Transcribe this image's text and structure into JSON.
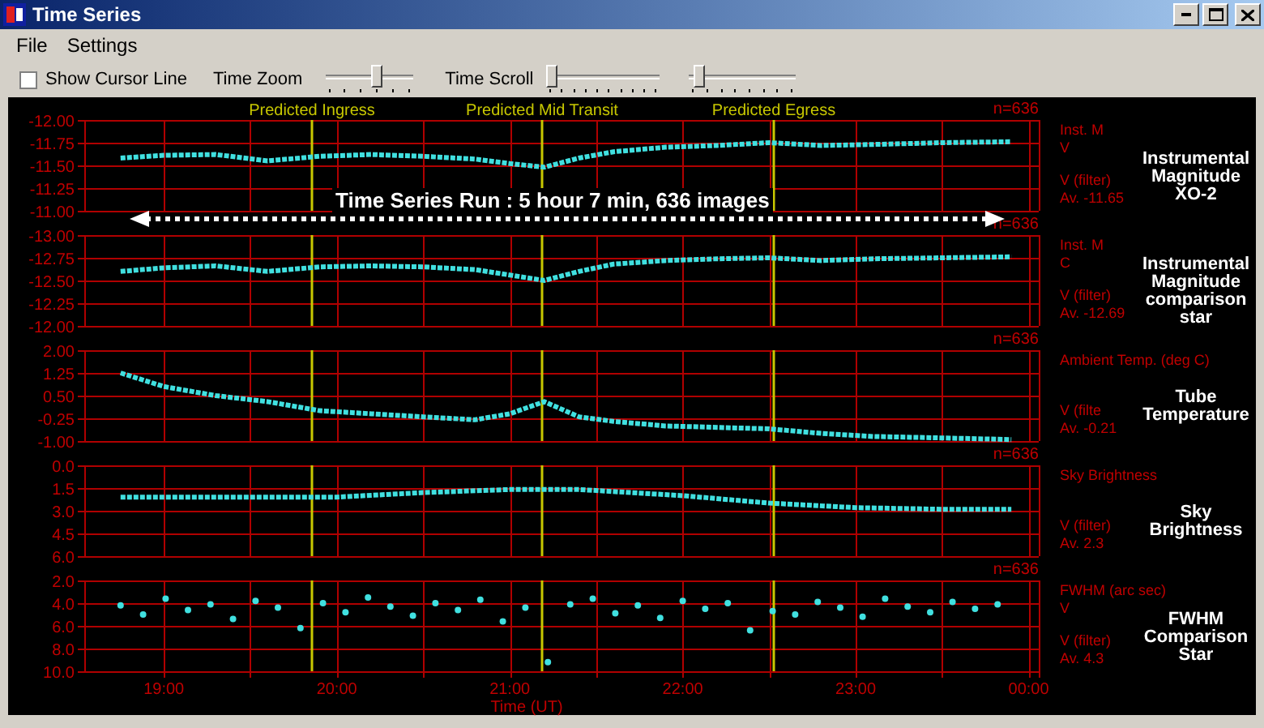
{
  "window": {
    "title": "Time Series"
  },
  "menu": [
    {
      "label": "File"
    },
    {
      "label": "Settings"
    }
  ],
  "toolbar": {
    "show_cursor_line": {
      "label": "Show Cursor Line",
      "checked": false
    },
    "time_zoom": {
      "label": "Time Zoom",
      "level": 0.6
    },
    "time_scroll": {
      "label": "Time Scroll",
      "level": 0.0
    },
    "slider_3": {
      "level": 0.05
    }
  },
  "run_annotation": "Time Series Run : 5 hour 7 min, 636 images",
  "panels": [
    {
      "count": "n=636",
      "quantity": "Inst. M",
      "unit": "V",
      "filter": "V (filter)",
      "average": "Av.  -11.65",
      "note": "Instrumental Magnitude XO-2",
      "chart_data": {
        "type": "line",
        "grid": true,
        "x": [
          18.75,
          19.0,
          19.3,
          19.6,
          19.9,
          20.2,
          20.5,
          20.8,
          21.0,
          21.2,
          21.4,
          21.6,
          21.9,
          22.2,
          22.5,
          22.8,
          23.1,
          23.5,
          23.9
        ],
        "series": [
          {
            "color": "#40e0e0",
            "line_style": "dotted",
            "values": [
              -11.58,
              -11.61,
              -11.62,
              -11.55,
              -11.6,
              -11.62,
              -11.6,
              -11.57,
              -11.52,
              -11.48,
              -11.58,
              -11.65,
              -11.7,
              -11.72,
              -11.75,
              -11.72,
              -11.73,
              -11.75,
              -11.76
            ]
          }
        ],
        "xlim": [
          18.54,
          24.03
        ],
        "ylim": [
          -11,
          -12
        ],
        "yticks": [
          {
            "value": -12,
            "label": "-12.00"
          },
          {
            "value": -11.75,
            "label": "-11.75"
          },
          {
            "value": -11.5,
            "label": "-11.50"
          },
          {
            "value": -11.25,
            "label": "-11.25"
          },
          {
            "value": -11,
            "label": "-11.00"
          }
        ],
        "ref_lines": [
          {
            "axis": "x",
            "value": 19.85,
            "color": "#c8c800",
            "label": "Predicted Ingress"
          },
          {
            "axis": "x",
            "value": 21.18,
            "color": "#c8c800",
            "label": "Predicted Mid Transit"
          },
          {
            "axis": "x",
            "value": 22.52,
            "color": "#c8c800",
            "label": "Predicted Egress"
          }
        ]
      }
    },
    {
      "count": "n=636",
      "quantity": "Inst. M",
      "unit": "C",
      "filter": "V (filter)",
      "average": "Av.  -12.69",
      "note": "Instrumental Magnitude comparison star",
      "chart_data": {
        "type": "line",
        "grid": true,
        "x": [
          18.75,
          19.0,
          19.3,
          19.6,
          19.9,
          20.2,
          20.5,
          20.8,
          21.0,
          21.2,
          21.4,
          21.6,
          21.9,
          22.2,
          22.5,
          22.8,
          23.1,
          23.5,
          23.9
        ],
        "series": [
          {
            "color": "#40e0e0",
            "line_style": "dotted",
            "values": [
              -12.6,
              -12.64,
              -12.66,
              -12.6,
              -12.65,
              -12.66,
              -12.65,
              -12.62,
              -12.56,
              -12.5,
              -12.6,
              -12.68,
              -12.72,
              -12.74,
              -12.75,
              -12.72,
              -12.74,
              -12.75,
              -12.76
            ]
          }
        ],
        "xlim": [
          18.54,
          24.03
        ],
        "ylim": [
          -12,
          -13
        ],
        "yticks": [
          {
            "value": -13,
            "label": "-13.00"
          },
          {
            "value": -12.75,
            "label": "-12.75"
          },
          {
            "value": -12.5,
            "label": "-12.50"
          },
          {
            "value": -12.25,
            "label": "-12.25"
          },
          {
            "value": -12,
            "label": "-12.00"
          }
        ],
        "ref_lines": [
          {
            "axis": "x",
            "value": 19.85,
            "color": "#c8c800"
          },
          {
            "axis": "x",
            "value": 21.18,
            "color": "#c8c800"
          },
          {
            "axis": "x",
            "value": 22.52,
            "color": "#c8c800"
          }
        ]
      }
    },
    {
      "count": "n=636",
      "quantity": "Ambient Temp. (deg C)",
      "filter": "V (filte",
      "average": "Av.  -0.21",
      "note": "Tube Temperature",
      "chart_data": {
        "type": "line",
        "grid": true,
        "x": [
          18.75,
          19.0,
          19.3,
          19.6,
          19.9,
          20.2,
          20.5,
          20.8,
          21.0,
          21.2,
          21.4,
          21.6,
          21.9,
          22.2,
          22.5,
          22.8,
          23.1,
          23.5,
          23.9
        ],
        "series": [
          {
            "color": "#40e0e0",
            "line_style": "dotted",
            "values": [
              1.25,
              0.8,
              0.5,
              0.3,
              0.0,
              -0.1,
              -0.2,
              -0.3,
              -0.1,
              0.3,
              -0.2,
              -0.35,
              -0.5,
              -0.55,
              -0.6,
              -0.75,
              -0.85,
              -0.9,
              -0.95
            ]
          }
        ],
        "xlim": [
          18.54,
          24.03
        ],
        "ylim": [
          -1,
          2
        ],
        "yticks": [
          {
            "value": 2,
            "label": "2.00"
          },
          {
            "value": 1.25,
            "label": "1.25"
          },
          {
            "value": 0.5,
            "label": "0.50"
          },
          {
            "value": -0.25,
            "label": "-0.25"
          },
          {
            "value": -1,
            "label": "-1.00"
          }
        ],
        "ref_lines": [
          {
            "axis": "x",
            "value": 19.85,
            "color": "#c8c800"
          },
          {
            "axis": "x",
            "value": 21.18,
            "color": "#c8c800"
          },
          {
            "axis": "x",
            "value": 22.52,
            "color": "#c8c800"
          }
        ]
      }
    },
    {
      "count": "n=636",
      "quantity": "Sky Brightness",
      "filter": "V (filter)",
      "average": "Av.  2.3",
      "note": "Sky Brightness",
      "chart_data": {
        "type": "line",
        "grid": true,
        "x": [
          18.75,
          19.0,
          19.5,
          20.0,
          20.5,
          21.0,
          21.4,
          22.0,
          22.5,
          23.0,
          23.5,
          23.9
        ],
        "series": [
          {
            "color": "#40e0e0",
            "line_style": "dotted",
            "values": [
              2.1,
              2.1,
              2.1,
              2.1,
              1.8,
              1.6,
              1.6,
              2.0,
              2.5,
              2.8,
              2.9,
              2.9
            ]
          }
        ],
        "xlim": [
          18.54,
          24.03
        ],
        "ylim": [
          6,
          0
        ],
        "yticks": [
          {
            "value": 0,
            "label": "0.0"
          },
          {
            "value": 1.5,
            "label": "1.5"
          },
          {
            "value": 3,
            "label": "3.0"
          },
          {
            "value": 4.5,
            "label": "4.5"
          },
          {
            "value": 6,
            "label": "6.0"
          }
        ],
        "ref_lines": [
          {
            "axis": "x",
            "value": 19.85,
            "color": "#c8c800"
          },
          {
            "axis": "x",
            "value": 21.18,
            "color": "#c8c800"
          },
          {
            "axis": "x",
            "value": 22.52,
            "color": "#c8c800"
          }
        ]
      }
    },
    {
      "count": "n=636",
      "quantity": "FWHM (arc sec)",
      "unit": "V",
      "filter": "V (filter)",
      "average": "Av.  4.3",
      "note": "FWHM Comparison Star",
      "chart_data": {
        "type": "scatter",
        "grid": true,
        "x": [
          18.75,
          18.88,
          19.01,
          19.14,
          19.27,
          19.4,
          19.53,
          19.66,
          19.79,
          19.92,
          20.05,
          20.18,
          20.31,
          20.44,
          20.57,
          20.7,
          20.83,
          20.96,
          21.09,
          21.22,
          21.35,
          21.48,
          21.61,
          21.74,
          21.87,
          22.0,
          22.13,
          22.26,
          22.39,
          22.52,
          22.65,
          22.78,
          22.91,
          23.04,
          23.17,
          23.3,
          23.43,
          23.56,
          23.69,
          23.82
        ],
        "series": [
          {
            "color": "#40e0e0",
            "values": [
              4.2,
              5.0,
              3.6,
              4.6,
              4.1,
              5.4,
              3.8,
              4.4,
              6.2,
              4.0,
              4.8,
              3.5,
              4.3,
              5.1,
              4.0,
              4.6,
              3.7,
              5.6,
              4.4,
              9.2,
              4.1,
              3.6,
              4.9,
              4.2,
              5.3,
              3.8,
              4.5,
              4.0,
              6.4,
              4.7,
              5.0,
              3.9,
              4.4,
              5.2,
              3.6,
              4.3,
              4.8,
              3.9,
              4.5,
              4.1
            ]
          }
        ],
        "xlim": [
          18.54,
          24.03
        ],
        "ylim": [
          10,
          2
        ],
        "yticks": [
          {
            "value": 2,
            "label": "2.0"
          },
          {
            "value": 4,
            "label": "4.0"
          },
          {
            "value": 6,
            "label": "6.0"
          },
          {
            "value": 8,
            "label": "8.0"
          },
          {
            "value": 10,
            "label": "10.0"
          }
        ],
        "xticks": [
          {
            "value": 19,
            "label": "19:00"
          },
          {
            "value": 20,
            "label": "20:00"
          },
          {
            "value": 21,
            "label": "21:00"
          },
          {
            "value": 22,
            "label": "22:00"
          },
          {
            "value": 23,
            "label": "23:00"
          },
          {
            "value": 24,
            "label": "00:00"
          }
        ],
        "xlabel": "Time (UT)",
        "ref_lines": [
          {
            "axis": "x",
            "value": 19.85,
            "color": "#c8c800"
          },
          {
            "axis": "x",
            "value": 21.18,
            "color": "#c8c800"
          },
          {
            "axis": "x",
            "value": 22.52,
            "color": "#c8c800"
          }
        ]
      }
    }
  ]
}
